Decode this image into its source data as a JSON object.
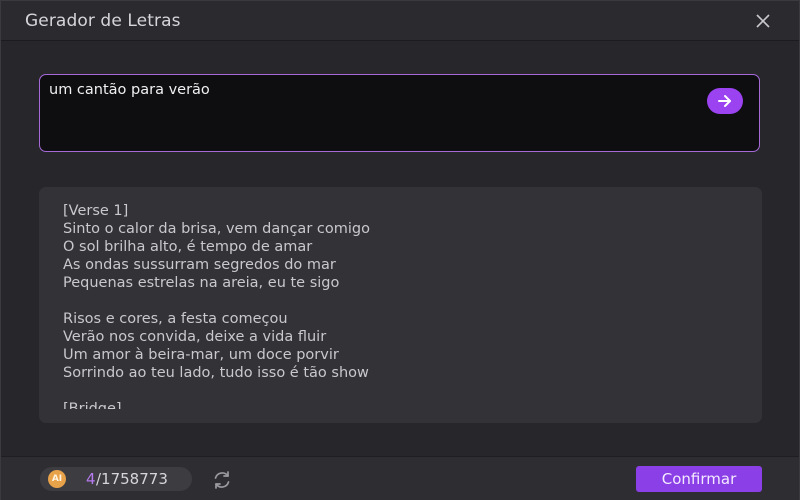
{
  "window": {
    "title": "Gerador de Letras"
  },
  "prompt": {
    "value": "um cantão para verão"
  },
  "lyrics": {
    "text": "[Verse 1]\nSinto o calor da brisa, vem dançar comigo\nO sol brilha alto, é tempo de amar\nAs ondas sussurram segredos do mar\nPequenas estrelas na areia, eu te sigo\n\nRisos e cores, a festa começou\nVerão nos convida, deixe a vida fluir\nUm amor à beira-mar, um doce porvir\nSorrindo ao teu lado, tudo isso é tão show\n\n[Bridge]"
  },
  "footer": {
    "ai_badge": "AI",
    "credits_used": "4",
    "credits_total": "/1758773",
    "confirm_label": "Confirmar"
  },
  "colors": {
    "accent": "#9b43f0",
    "confirm": "#8b3fe6",
    "coin": "#e8a24a"
  },
  "icons": {
    "close": "close-icon",
    "send": "arrow-right-icon",
    "refresh": "refresh-icon",
    "coin": "ai-coin-icon"
  }
}
